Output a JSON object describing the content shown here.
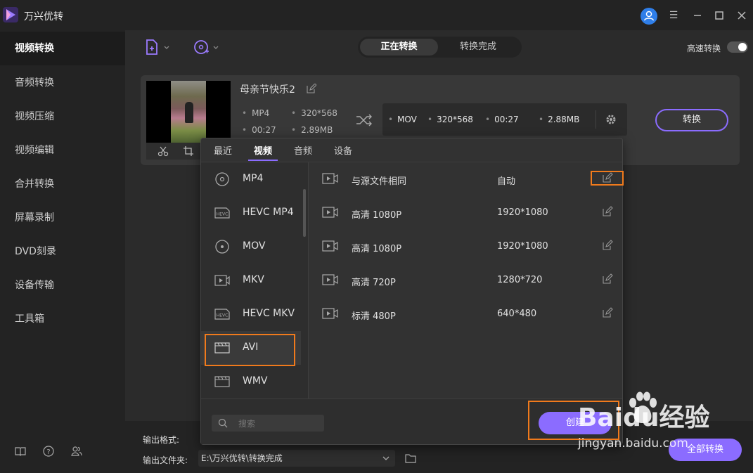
{
  "app": {
    "title": "万兴优转"
  },
  "sidebar": {
    "items": [
      {
        "label": "视频转换",
        "active": true
      },
      {
        "label": "音频转换"
      },
      {
        "label": "视频压缩"
      },
      {
        "label": "视频编辑"
      },
      {
        "label": "合并转换"
      },
      {
        "label": "屏幕录制"
      },
      {
        "label": "DVD刻录"
      },
      {
        "label": "设备传输"
      },
      {
        "label": "工具箱"
      }
    ],
    "bottom_icons": [
      "book-icon",
      "help-icon",
      "users-icon"
    ]
  },
  "toolbar": {
    "tabs": [
      {
        "label": "正在转换",
        "active": true
      },
      {
        "label": "转换完成"
      }
    ],
    "fast_convert_label": "高速转换",
    "fast_convert_on": false
  },
  "file": {
    "name": "母亲节快乐2",
    "source": {
      "format": "MP4",
      "resolution": "320*568",
      "duration": "00:27",
      "size": "2.89MB"
    },
    "target": {
      "format": "MOV",
      "resolution": "320*568",
      "duration": "00:27",
      "size": "2.88MB"
    },
    "convert_label": "转换"
  },
  "bottom": {
    "output_format_label": "输出格式:",
    "output_folder_label": "输出文件夹:",
    "output_path": "E:\\万兴优转\\转换完成",
    "convert_all_label": "全部转换"
  },
  "popup": {
    "tabs": [
      {
        "label": "最近"
      },
      {
        "label": "视频",
        "active": true
      },
      {
        "label": "音频"
      },
      {
        "label": "设备"
      }
    ],
    "formats": [
      {
        "label": "MP4",
        "icon": "disc-icon"
      },
      {
        "label": "HEVC MP4",
        "icon": "hevc-icon"
      },
      {
        "label": "MOV",
        "icon": "disc-icon"
      },
      {
        "label": "MKV",
        "icon": "video-file-icon"
      },
      {
        "label": "HEVC MKV",
        "icon": "hevc-icon"
      },
      {
        "label": "AVI",
        "icon": "clapper-icon",
        "selected": true
      },
      {
        "label": "WMV",
        "icon": "clapper-icon"
      }
    ],
    "qualities": [
      {
        "name": "与源文件相同",
        "resolution": "自动"
      },
      {
        "name": "高清 1080P",
        "resolution": "1920*1080"
      },
      {
        "name": "高清 1080P",
        "resolution": "1920*1080"
      },
      {
        "name": "高清 720P",
        "resolution": "1280*720"
      },
      {
        "name": "标清 480P",
        "resolution": "640*480"
      }
    ],
    "search_placeholder": "搜索",
    "create_label": "创建"
  },
  "watermark": {
    "brand": "Baidu经验",
    "url": "jingyan.baidu.com"
  },
  "colors": {
    "accent": "#8b6cff",
    "highlight": "#f07a1c",
    "avatar": "#2f7ee8"
  }
}
